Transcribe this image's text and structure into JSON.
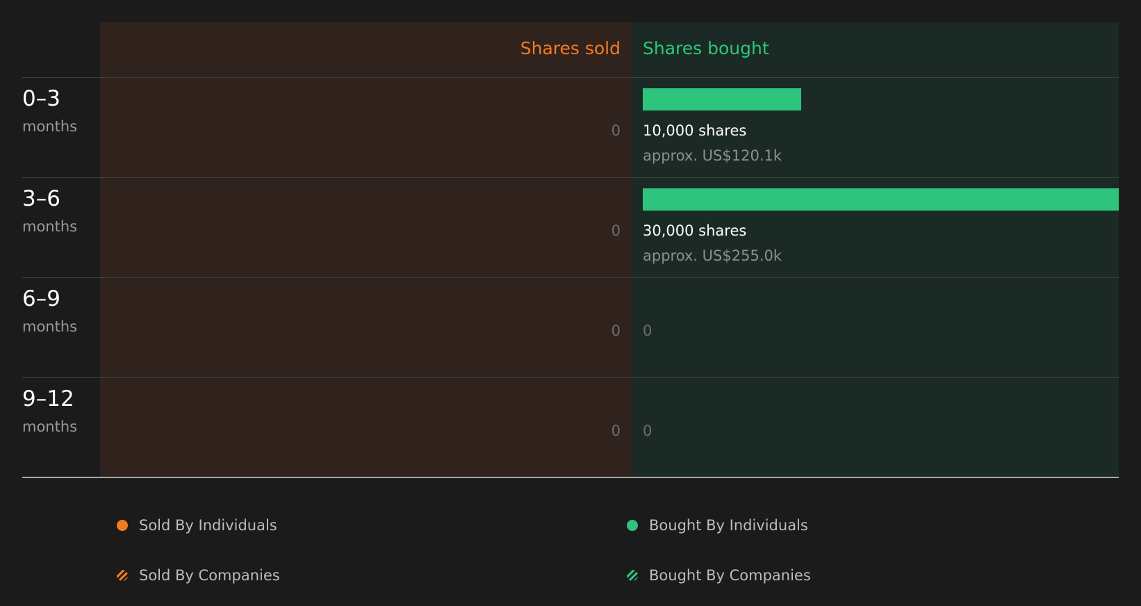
{
  "colors": {
    "sold": "#f47a22",
    "bought": "#2ec47d",
    "sold_panel_bg": "#30231d",
    "bought_panel_bg": "#1b2a24",
    "page_bg": "#1b1b1b"
  },
  "header": {
    "sold_label": "Shares sold",
    "bought_label": "Shares bought"
  },
  "rows": [
    {
      "period": "0–3",
      "unit": "months",
      "sold_value": "0",
      "bought_shares": "10,000 shares",
      "bought_approx": "approx. US$120.1k"
    },
    {
      "period": "3–6",
      "unit": "months",
      "sold_value": "0",
      "bought_shares": "30,000 shares",
      "bought_approx": "approx. US$255.0k"
    },
    {
      "period": "6–9",
      "unit": "months",
      "sold_value": "0",
      "bought_value": "0"
    },
    {
      "period": "9–12",
      "unit": "months",
      "sold_value": "0",
      "bought_value": "0"
    }
  ],
  "legend": {
    "sold_individuals": "Sold By Individuals",
    "bought_individuals": "Bought By Individuals",
    "sold_companies": "Sold By Companies",
    "bought_companies": "Bought By Companies"
  },
  "chart_data": {
    "type": "bar",
    "categories": [
      "0–3",
      "3–6",
      "6–9",
      "9–12"
    ],
    "series": [
      {
        "name": "Shares sold",
        "values": [
          0,
          0,
          0,
          0
        ]
      },
      {
        "name": "Shares bought",
        "values": [
          10000,
          30000,
          0,
          0
        ]
      }
    ],
    "bought_value_usd_k": [
      120.1,
      255.0,
      null,
      null
    ],
    "xlabel": "",
    "ylabel": "",
    "legend": [
      "Sold By Individuals",
      "Bought By Individuals",
      "Sold By Companies",
      "Bought By Companies"
    ],
    "legend_position": "bottom"
  }
}
